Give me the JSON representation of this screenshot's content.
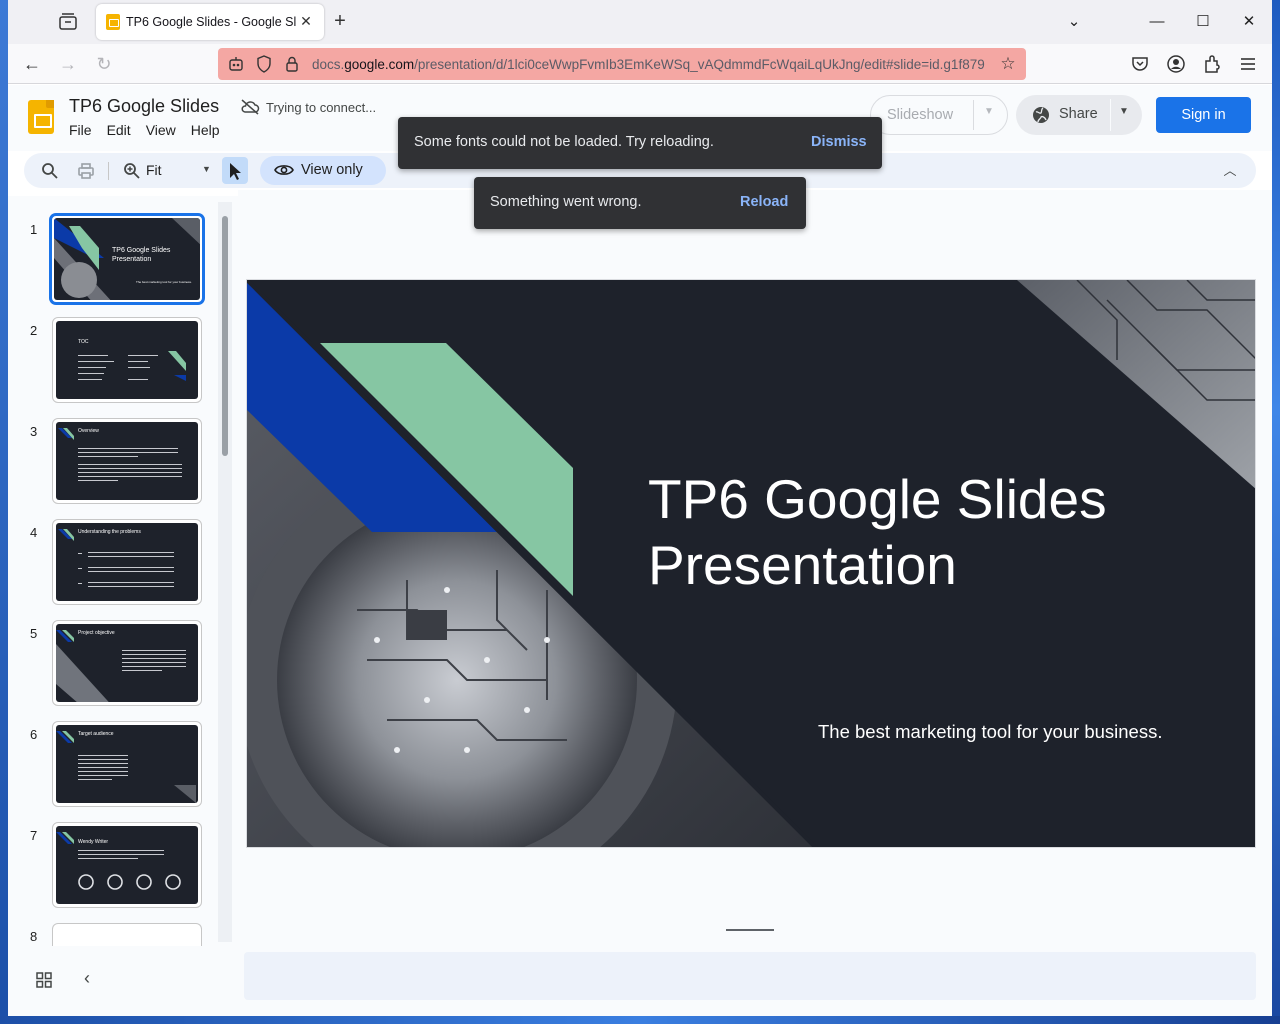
{
  "browser": {
    "tab_title": "TP6 Google Slides - Google Slides",
    "url_prefix": "docs.",
    "url_domain": "google.com",
    "url_path": "/presentation/d/1lci0ceWwpFvmIb3EmKeWSq_vAQdmmdFcWqaiLqUkJng/edit#slide=id.g1f879"
  },
  "app": {
    "doc_title": "TP6 Google Slides",
    "status_text": "Trying to connect...",
    "menus": [
      "File",
      "Edit",
      "View",
      "Help"
    ],
    "slideshow_label": "Slideshow",
    "share_label": "Share",
    "signin_label": "Sign in",
    "accent": "#1a73e8"
  },
  "toolbar": {
    "zoom_label": "Fit",
    "view_only_label": "View only"
  },
  "snackbars": [
    {
      "message": "Some fonts could not be loaded. Try reloading.",
      "action": "Dismiss"
    },
    {
      "message": "Something went wrong.",
      "action": "Reload"
    }
  ],
  "filmstrip": {
    "slides": [
      {
        "number": "1",
        "title": "TP6 Google Slides Presentation",
        "subtitle": "The best marketing tool for your business."
      },
      {
        "number": "2",
        "title": "TOC"
      },
      {
        "number": "3",
        "title": "Overview"
      },
      {
        "number": "4",
        "title": "Understanding the problems"
      },
      {
        "number": "5",
        "title": "Project objective"
      },
      {
        "number": "6",
        "title": "Target audience"
      },
      {
        "number": "7",
        "title": "Wendy Writer"
      },
      {
        "number": "8",
        "title": ""
      }
    ]
  },
  "slide": {
    "title": "TP6 Google Slides Presentation",
    "subtitle": "The best marketing tool for your business.",
    "colors": {
      "background": "#1e222b",
      "blue": "#0b3aa8",
      "green": "#86c6a3"
    }
  }
}
